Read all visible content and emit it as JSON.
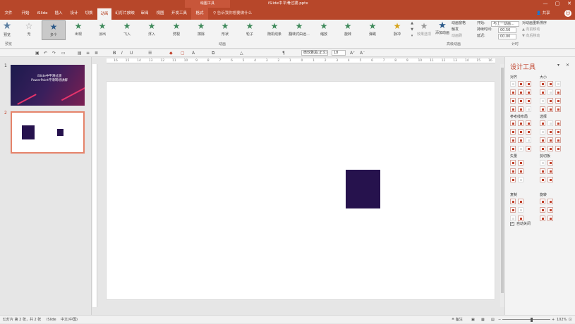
{
  "titlebar": {
    "context": "绘图工具",
    "document": "iSlide中平滑过渡.pptx",
    "minimize": "—",
    "restore": "▢",
    "close": "✕"
  },
  "tabs": [
    "文件",
    "开始",
    "iSlide",
    "插入",
    "设计",
    "切换",
    "动画",
    "幻灯片放映",
    "审阅",
    "视图",
    "开发工具",
    "格式"
  ],
  "tell_me": "告诉我你想要做什么",
  "share": "共享",
  "ribbon": {
    "preview_label": "预览",
    "animations": [
      "无",
      "多个",
      "出现",
      "淡出",
      "飞入",
      "浮入",
      "劈裂",
      "擦除",
      "形状",
      "轮子",
      "随机线条",
      "翻转式由远...",
      "缩放",
      "旋转",
      "弹跳",
      "脉冲"
    ],
    "effect_options": "效果选项",
    "add_animation": "添加动画",
    "animation_pane": "动画窗格",
    "trigger": "触发",
    "animation_painter": "动画刷",
    "start_label": "开始:",
    "start_value": "与上一动画...",
    "duration_label": "持续时间:",
    "duration_value": "00.50",
    "delay_label": "延迟:",
    "delay_value": "00.00",
    "reorder": "对动画重新排序",
    "move_earlier": "▲ 向前移动",
    "move_later": "▼ 向后移动",
    "groups": {
      "preview": "预览",
      "animation": "动画",
      "advanced": "高级动画",
      "timing": "计时"
    }
  },
  "quickbar": {
    "font_name": "微软雅黑(正文)",
    "font_size": "18"
  },
  "thumbnails": [
    {
      "num": "1",
      "title": "iSlide中平滑过渡",
      "subtitle": "PowerPoint平滑转场讲解"
    },
    {
      "num": "2"
    }
  ],
  "ruler_ticks": [
    "16",
    "15",
    "14",
    "13",
    "12",
    "11",
    "10",
    "9",
    "8",
    "7",
    "6",
    "5",
    "4",
    "3",
    "2",
    "1",
    "0",
    "1",
    "2",
    "3",
    "4",
    "5",
    "6",
    "7",
    "8",
    "9",
    "10",
    "11",
    "12",
    "13",
    "14",
    "15",
    "16"
  ],
  "pane": {
    "title": "设计工具",
    "sections": {
      "align": "对齐",
      "size": "大小",
      "guides": "参考线布局",
      "select": "选择",
      "vector": "矢量",
      "clipboard": "剪切板",
      "rotate": "旋转",
      "copy": "复制"
    },
    "auto_close": "自动关闭"
  },
  "status": {
    "slide": "幻灯片 第 2 张，共 2 张",
    "app": "iSlide",
    "lang": "中文(中国)",
    "notes": "备注",
    "zoom": "102%"
  },
  "colors": {
    "accent": "#b7472a",
    "shape": "#26124d"
  }
}
